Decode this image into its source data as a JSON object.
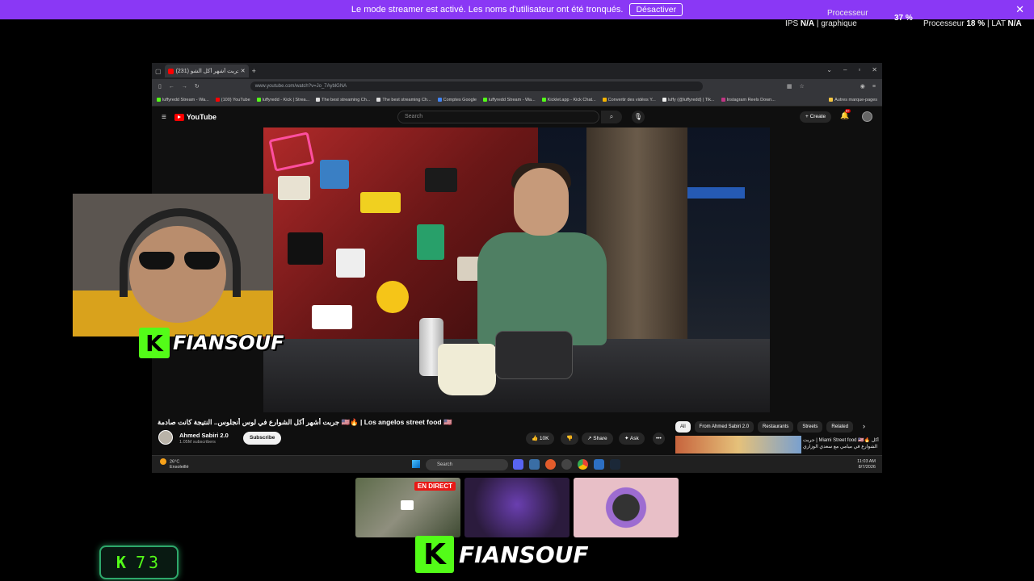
{
  "banner": {
    "message": "Le mode streamer est activé. Les noms d'utilisateur ont été tronqués.",
    "button_label": "Désactiver",
    "close_glyph": "✕"
  },
  "perf": {
    "ips_label": "IPS",
    "ips_value": "N/A",
    "graphique_label": "graphique",
    "cpu_top_label": "Processeur",
    "gpu_pct": "37 %",
    "cpu_label": "Processeur",
    "cpu_value": "18 %",
    "lat_label": "LAT",
    "lat_value": "N/A",
    "sep": "|"
  },
  "browser": {
    "tab_title": "جربت أشهر أكل الشو (231)",
    "url": "www.youtube.com/watch?v=Jo_7AyblGNA",
    "bookmarks": [
      "luffyredd Stream - Wa...",
      "(100) YouTube",
      "luffyredd - Kick | Strea...",
      "The best streaming Ch...",
      "The best streaming Ch...",
      "Comptes Google",
      "luffyredd Stream - Wa...",
      "Kicklet.app - Kick Chat...",
      "Convertir des vidéos Y...",
      "luffy (@luffyredd) | Tik...",
      "Instagram Reels Down..."
    ],
    "bookmarks_other": "Autres marque-pages"
  },
  "youtube": {
    "logo": "YouTube",
    "search_placeholder": "Search",
    "create_label": "Create",
    "notif_count": "9+",
    "video_title": "جربت أشهر أكل الشوارع في لوس أنجلوس.. النتيجة كانت صادمة 🇺🇸🔥 | Los angelos street food 🇺🇸",
    "channel_name": "Ahmed Sabiri 2.0",
    "subscribers": "1.05M subscribers",
    "subscribe_label": "Subscribe",
    "likes": "10K",
    "share_label": "Share",
    "ask_label": "Ask",
    "more": "•••",
    "chips": [
      "All",
      "From Ahmed Sabiri 2.0",
      "Restaurants",
      "Streets",
      "Related"
    ],
    "rec_title": "جربت | Miami Street food 🇺🇸🔥 أكل الشوارع في ميامي مع سعدي الوزاري"
  },
  "taskbar": {
    "temperature": "26°C",
    "weather": "Ensoleillé",
    "search_placeholder": "Search",
    "time": "11:03 AM",
    "date": "8/7/2026"
  },
  "overlay": {
    "streamer_name": "FIANSOUF",
    "kick_letter": "K",
    "live_badge": "EN DIRECT",
    "counter_value": "73"
  },
  "colors": {
    "banner": "#8a38f5",
    "kick_green": "#53fc18",
    "yt_red": "#ff0000"
  }
}
